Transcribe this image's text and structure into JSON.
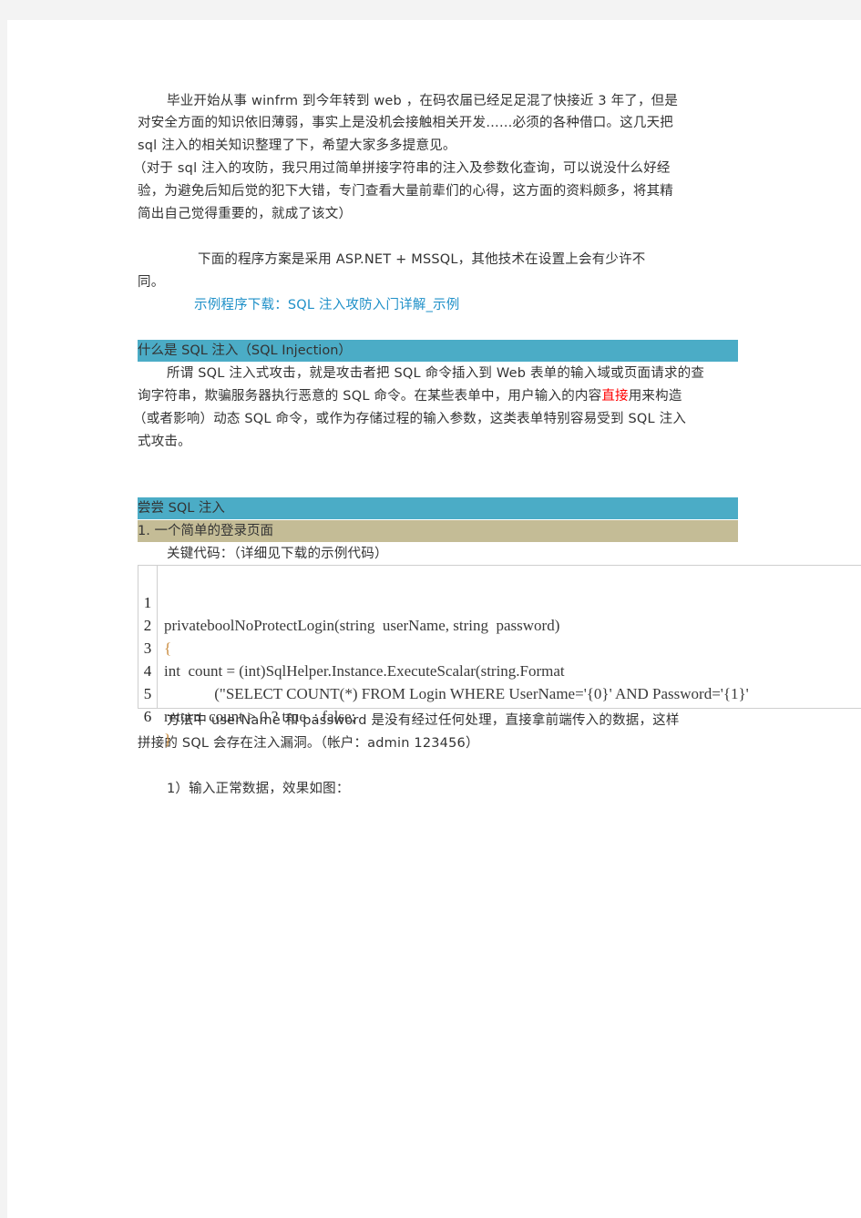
{
  "paragraphs": {
    "intro": {
      "lines": [
        "毕业开始从事 winfrm 到今年转到   web  ，在码农届已经足足混了快接近 3 年了，但是",
        "对安全方面的知识依旧薄弱，事实上是没机会接触相关开发……必须的各种借口。这几天把",
        "sql 注入的相关知识整理了下，希望大家多多提意见。"
      ]
    },
    "note": {
      "lines": [
        "（对于 sql 注入的攻防，我只用过简单拼接字符串的注入及参数化查询，可以说没什么好经",
        "验，为避免后知后觉的犯下大错，专门查看大量前辈们的心得，这方面的资料颇多，将其精",
        "简出自己觉得重要的，就成了该文）"
      ]
    },
    "tech": {
      "lines": [
        "下面的程序方案是采用   ASP.NET + MSSQL，其他技术在设置上会有少许不",
        "同。"
      ]
    },
    "download_link": "示例程序下载：SQL 注入攻防入门详解_示例"
  },
  "section1": {
    "heading": "什么是 SQL 注入（SQL Injection）",
    "lines": [
      "所谓 SQL 注入式攻击，就是攻击者把 SQL 命令插入到 Web 表单的输入域或页面请求的查",
      "询字符串，欺骗服务器执行恶意的 SQL 命令。在某些表单中，用户输入的内容",
      "（或者影响）动态 SQL 命令，或作为存储过程的输入参数，这类表单特别容易受到 SQL 注入",
      "式攻击。"
    ],
    "highlight": "直接",
    "line2_tail": "用来构造"
  },
  "section2": {
    "heading": "尝尝 SQL 注入",
    "subheading": "1. 一个简单的登录页面",
    "key_code_label": "关键代码：（详细见下载的示例代码）",
    "code": {
      "line_numbers": [
        "1",
        "2",
        "3",
        "4",
        "5",
        "6"
      ],
      "lines": [
        "privateboolNoProtectLogin(string  userName, string  password)",
        "{",
        "int  count = (int)SqlHelper.Instance.ExecuteScalar(string.Format",
        "             (\"SELECT COUNT(*) FROM Login WHERE UserName='{0}' AND Password='{1}'",
        "return  count > 0 ? true  : false;",
        "}"
      ]
    },
    "explain_lines": [
      "方法中 userName 和   password  是没有经过任何处理，直接拿前端传入的数据，这样",
      "拼接的 SQL 会存在注入漏洞。（帐户：admin    123456）"
    ],
    "step1": "1）输入正常数据，效果如图："
  },
  "colors": {
    "heading_blue": "#4bacc6",
    "heading_tan": "#c4bc96",
    "link": "#1f90c8",
    "highlight_red": "#ff0000"
  }
}
